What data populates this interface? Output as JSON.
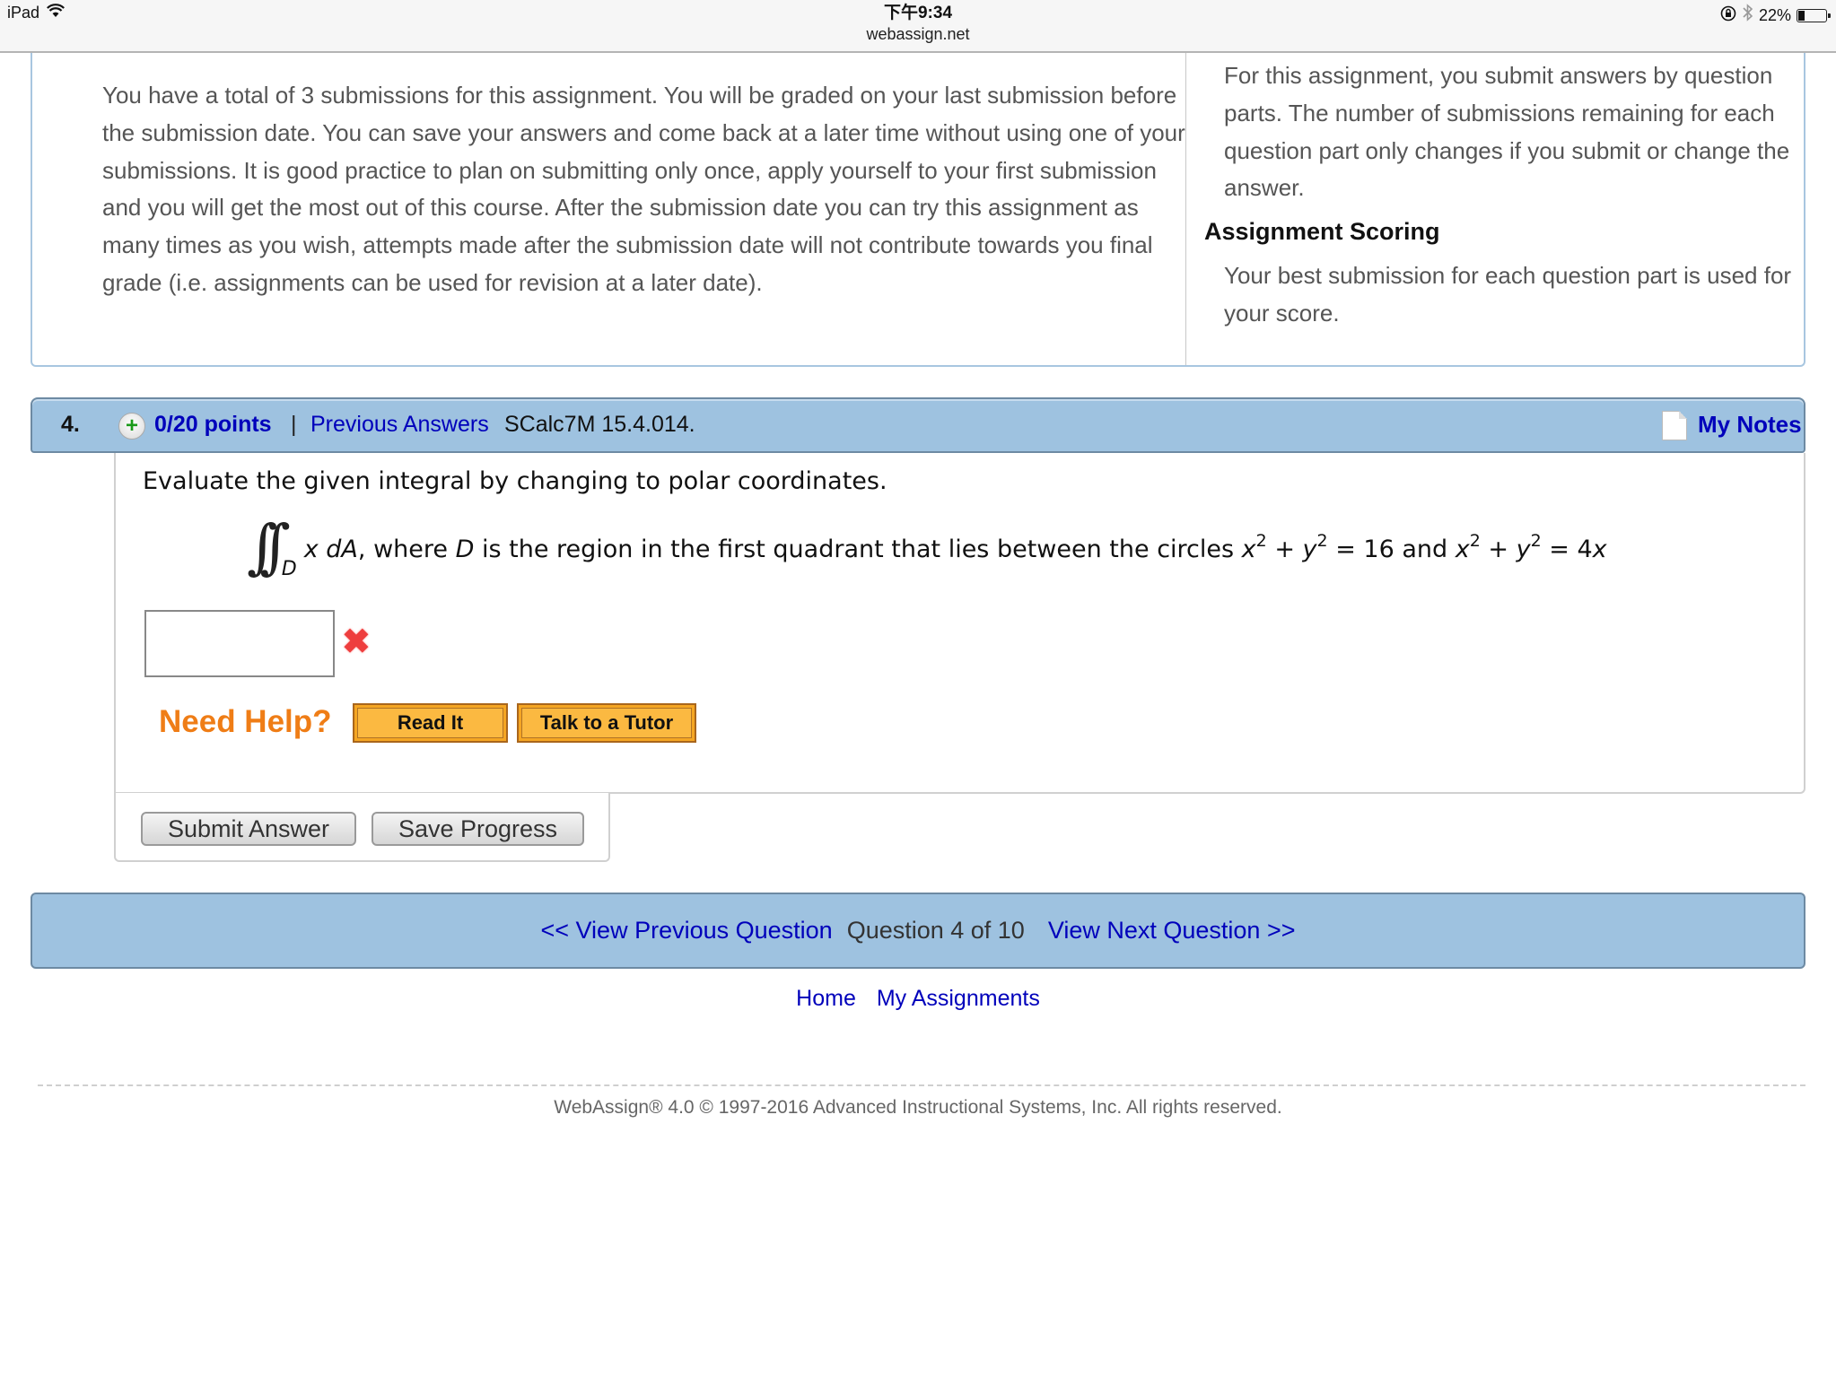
{
  "status_bar": {
    "device": "iPad",
    "time": "下午9:34",
    "url": "webassign.net",
    "battery_percent_label": "22%",
    "battery_level": 0.22,
    "icons": [
      "wifi-icon",
      "rotation-lock-icon",
      "bluetooth-icon",
      "battery-icon"
    ]
  },
  "info": {
    "submission_text": "You have a total of 3 submissions for this assignment. You will be graded on your last submission before the submission date. You can save your answers and come back at a later time without using one of your submissions. It is good practice to plan on submitting only once, apply yourself to your first submission and you will get the most out of this course. After the submission date you can try this assignment as many times as you wish, attempts made after the submission date will not contribute towards you final grade (i.e. assignments can be used for revision at a later date).",
    "parts_text": "For this assignment, you submit answers by question parts. The number of submissions remaining for each question part only changes if you submit or change the answer.",
    "scoring_heading": "Assignment Scoring",
    "scoring_text": "Your best submission for each question part is used for your score."
  },
  "question": {
    "number": "4.",
    "points": "0/20 points",
    "separator": "|",
    "previous_answers_label": "Previous Answers",
    "code": "SCalc7M 15.4.014.",
    "my_notes_label": "My Notes",
    "prompt": "Evaluate the given integral by changing to polar coordinates.",
    "integral_symbol": "∫∫",
    "integral_subscript": "D",
    "math": {
      "integrand": "x dA",
      "where": ", where ",
      "region_var": "D",
      "desc": " is the region in the first quadrant that lies between the circles ",
      "x": "x",
      "y": "y",
      "exp": "2",
      "plus": " + ",
      "eq1": " = 16 and ",
      "eq2": " = 4",
      "last_var": "x"
    },
    "answer_value": "",
    "answer_status": "incorrect",
    "incorrect_mark": "✖",
    "need_help_label": "Need Help?",
    "read_it_label": "Read It",
    "talk_tutor_label": "Talk to a Tutor",
    "submit_label": "Submit Answer",
    "save_label": "Save Progress"
  },
  "navigation": {
    "prev_label": "<< View Previous Question",
    "position_label": "Question 4 of 10",
    "next_label": "View Next Question >>"
  },
  "links": {
    "home": "Home",
    "my_assignments": "My Assignments"
  },
  "footer": {
    "copyright": "WebAssign® 4.0 © 1997-2016 Advanced Instructional Systems, Inc. All rights reserved."
  },
  "colors": {
    "header_bar": "#9ec2e0",
    "link": "#0000bb",
    "need_help": "#ef7d16",
    "help_button": "#fbb941",
    "incorrect": "#ee3e3e"
  }
}
